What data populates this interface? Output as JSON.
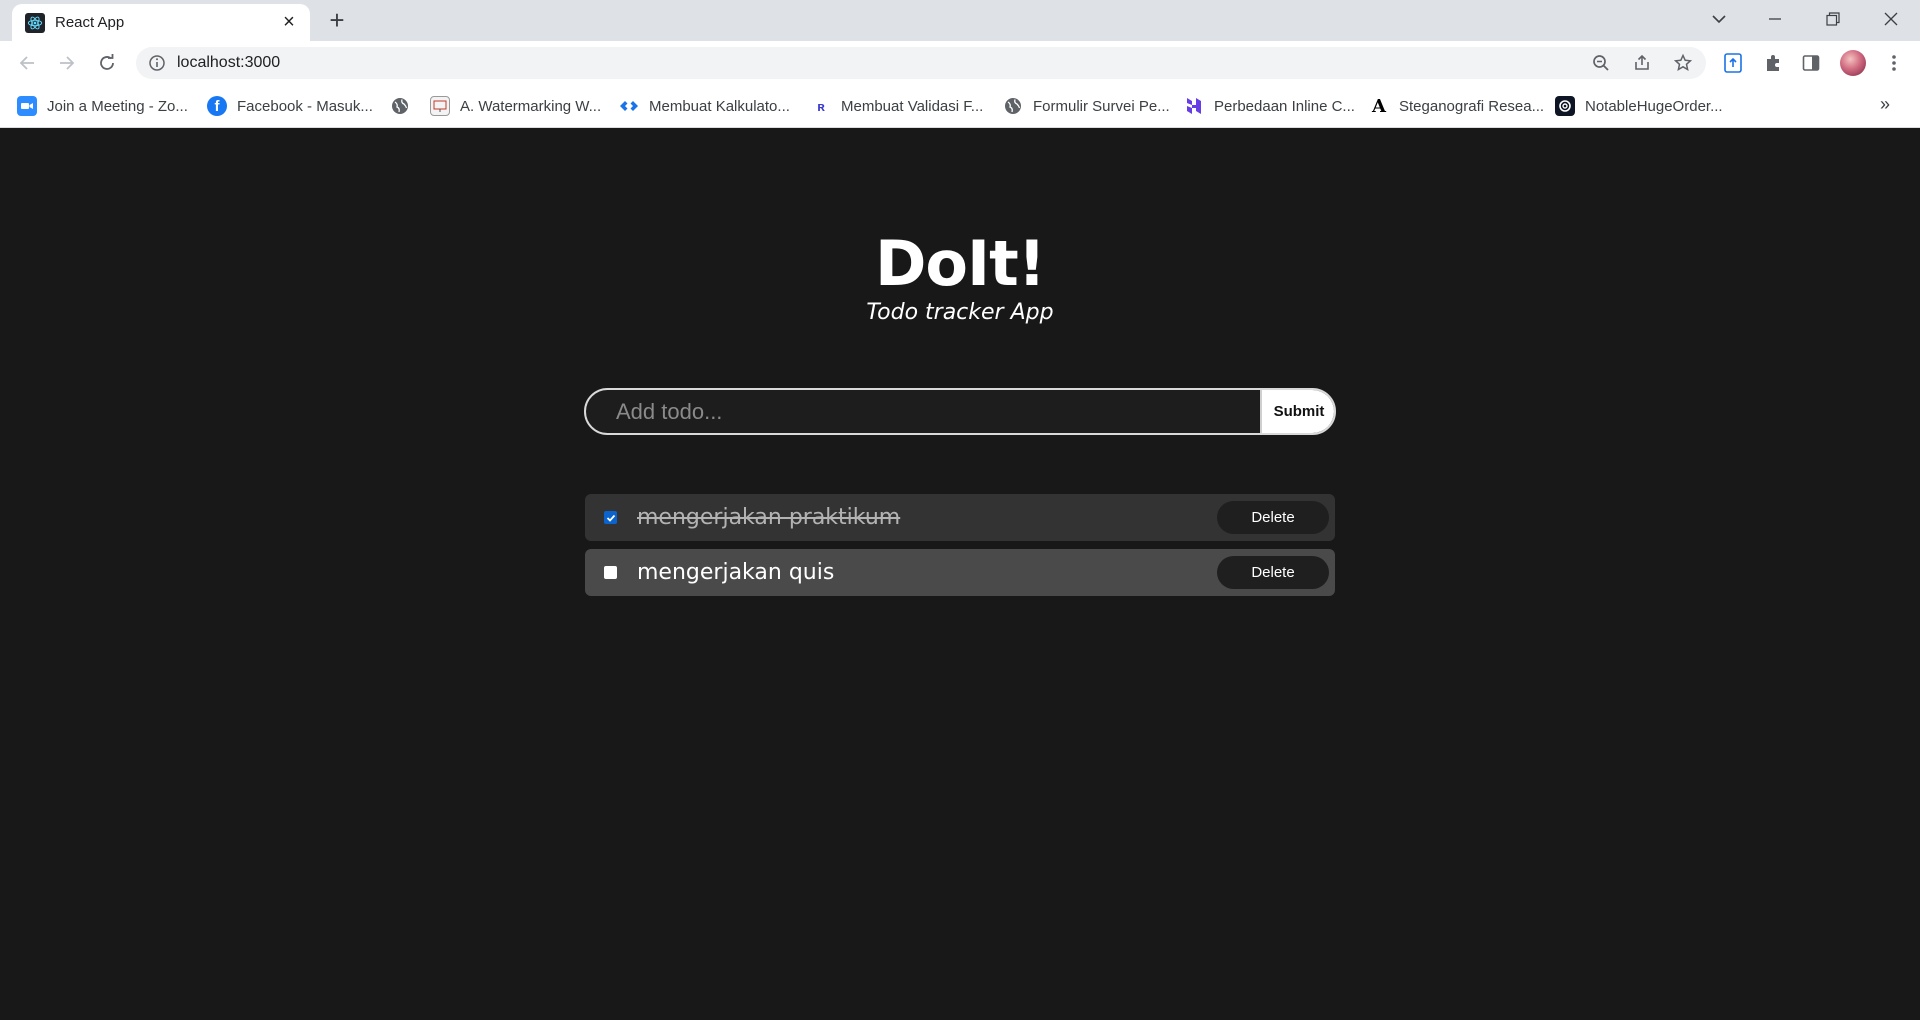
{
  "browser": {
    "tab": {
      "title": "React App",
      "favicon": "react-logo-icon"
    },
    "address": {
      "url": "localhost:3000"
    },
    "bookmarks": [
      {
        "label": "Join a Meeting - Zo...",
        "icon": "zoom-icon",
        "color": "#2d8cff"
      },
      {
        "label": "Facebook - Masuk...",
        "icon": "facebook-icon",
        "color": "#1877f2"
      },
      {
        "label": "",
        "icon": "globe-icon",
        "color": "#5f6368"
      },
      {
        "label": "A. Watermarking W...",
        "icon": "slides-icon",
        "color": "#e8e8e8"
      },
      {
        "label": "Membuat Kalkulato...",
        "icon": "diamond-icon",
        "color": "#1a73e8"
      },
      {
        "label": "Membuat Validasi F...",
        "icon": "font-icon",
        "color": "#3b3bd0"
      },
      {
        "label": "Formulir Survei Pe...",
        "icon": "globe-icon",
        "color": "#5f6368"
      },
      {
        "label": "Perbedaan Inline C...",
        "icon": "hostinger-icon",
        "color": "#673de6"
      },
      {
        "label": "Steganografi Resea...",
        "icon": "letter-a-icon",
        "color": "#000000"
      },
      {
        "label": "NotableHugeOrder...",
        "icon": "replit-icon",
        "color": "#0e1525"
      }
    ]
  },
  "app": {
    "title": "DoIt!",
    "subtitle": "Todo tracker App",
    "form": {
      "placeholder": "Add todo...",
      "value": "",
      "submit_label": "Submit"
    },
    "todos": [
      {
        "text": "mengerjakan praktikum",
        "completed": true,
        "delete_label": "Delete"
      },
      {
        "text": "mengerjakan quis",
        "completed": false,
        "delete_label": "Delete"
      }
    ]
  }
}
